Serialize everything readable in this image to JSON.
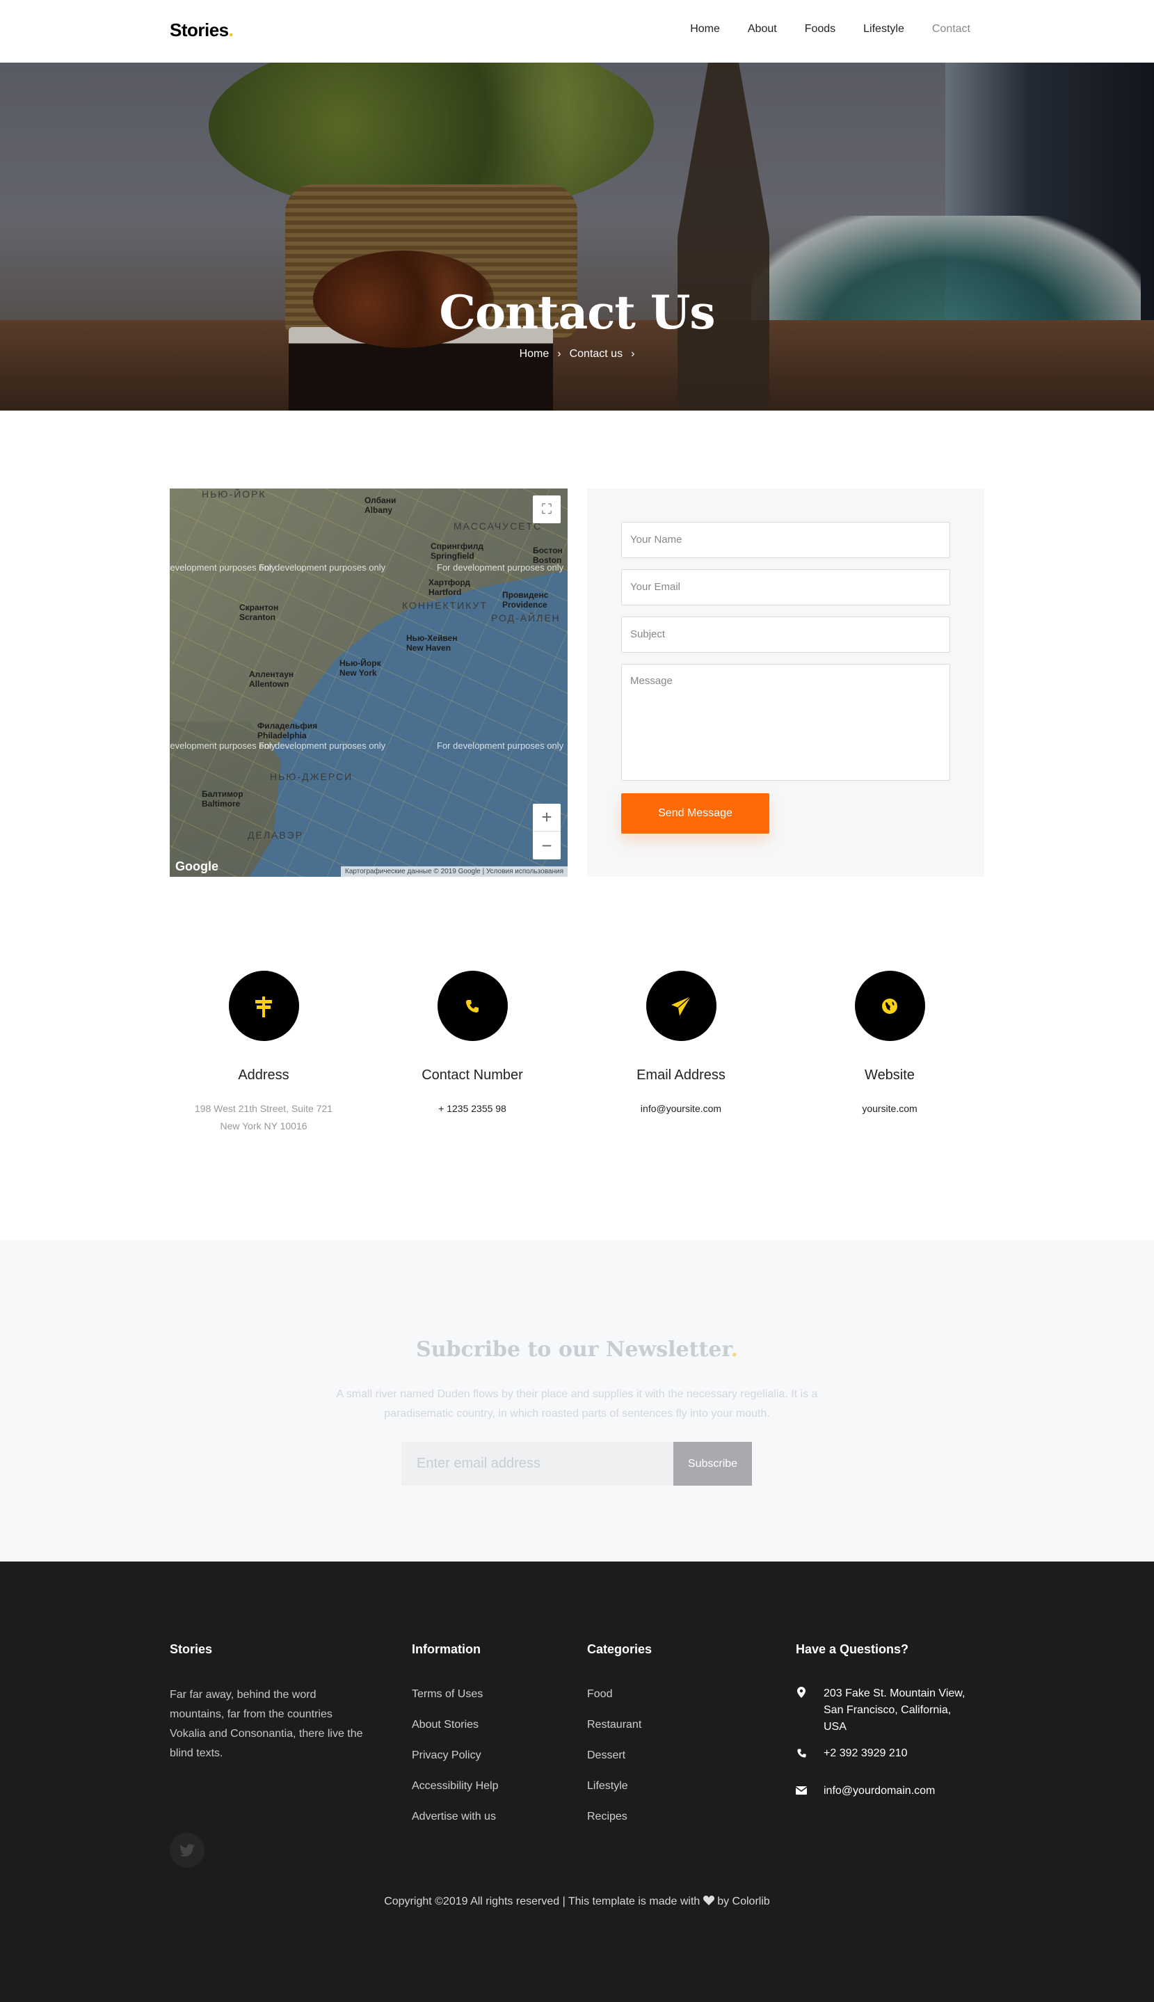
{
  "nav": {
    "brand": "Stories",
    "brand_dot": ".",
    "items": [
      {
        "label": "Home",
        "active": false
      },
      {
        "label": "About",
        "active": false
      },
      {
        "label": "Foods",
        "active": false
      },
      {
        "label": "Lifestyle",
        "active": false
      },
      {
        "label": "Contact",
        "active": true
      }
    ]
  },
  "hero": {
    "title": "Contact Us",
    "breadcrumb": [
      "Home",
      "Contact us"
    ],
    "breadcrumb_sep": "›"
  },
  "map": {
    "watermark": "For development purposes only",
    "labels": {
      "new_york_region": "НЬЮ-ЙОРК",
      "massachusetts": "МАССАЧУСЕТС",
      "connecticut": "КОННЕКТИКУТ",
      "rhode_island": "РОД-АЙЛЕН",
      "new_jersey": "НЬЮ-ДЖЕРСИ",
      "delaware": "ДЕЛАВЭР",
      "albany": "Олбани\nAlbany",
      "springfield": "Спрингфилд\nSpringfield",
      "boston": "Бостон\nBoston",
      "hartford": "Хартфорд\nHartford",
      "providence": "Провиденс\nProvidence",
      "new_haven": "Нью-Хейвен\nNew Haven",
      "new_york": "Нью-Йорк\nNew York",
      "allentown": "Аллентаун\nAllentown",
      "philadelphia": "Филадельфия\nPhiladelphia",
      "baltimore": "Балтимор\nBaltimore",
      "scranton": "Скрантон\nScranton"
    },
    "google": "Google",
    "attribution": "Картографические данные © 2019 Google | Условия использования",
    "zoom_in": "+",
    "zoom_out": "−",
    "fullscreen": "⛶"
  },
  "form": {
    "name_placeholder": "Your Name",
    "email_placeholder": "Your Email",
    "subject_placeholder": "Subject",
    "message_placeholder": "Message",
    "send_label": "Send Message"
  },
  "info": [
    {
      "icon": "signpost-icon",
      "title": "Address",
      "text_line1": "198 West 21th Street, Suite 721",
      "text_line2": "New York NY 10016"
    },
    {
      "icon": "phone-icon",
      "title": "Contact Number",
      "text_line1": "+ 1235 2355 98",
      "text_line2": ""
    },
    {
      "icon": "paper-plane-icon",
      "title": "Email Address",
      "text_line1": "info@yoursite.com",
      "text_line2": ""
    },
    {
      "icon": "globe-icon",
      "title": "Website",
      "text_line1": "yoursite.com",
      "text_line2": ""
    }
  ],
  "newsletter": {
    "title": "Subcribe to our Newsletter",
    "title_dot": ".",
    "text": "A small river named Duden flows by their place and supplies it with the necessary regelialia. It is a paradisematic country, in which roasted parts of sentences fly into your mouth.",
    "email_placeholder": "Enter email address",
    "button": "Subscribe"
  },
  "footer": {
    "about_title": "Stories",
    "about_text": "Far far away, behind the word mountains, far from the countries Vokalia and Consonantia, there live the blind texts.",
    "info_title": "Information",
    "info_links": [
      "Terms of Uses",
      "About Stories",
      "Privacy Policy",
      "Accessibility Help",
      "Advertise with us"
    ],
    "cat_title": "Categories",
    "cat_links": [
      "Food",
      "Restaurant",
      "Dessert",
      "Lifestyle",
      "Recipes"
    ],
    "q_title": "Have a Questions?",
    "address": "203 Fake St. Mountain View, San Francisco, California, USA",
    "phone": "+2 392 3929 210",
    "email": "info@yourdomain.com",
    "copyright_pre": "Copyright ©2019 All rights reserved | This template is made with",
    "copyright_post": "by Colorlib"
  },
  "colors": {
    "accent": "#ff6a06",
    "brand_dot": "#fbb811",
    "icon_yellow": "#fbd011",
    "footer_bg": "#1c1c1e"
  }
}
